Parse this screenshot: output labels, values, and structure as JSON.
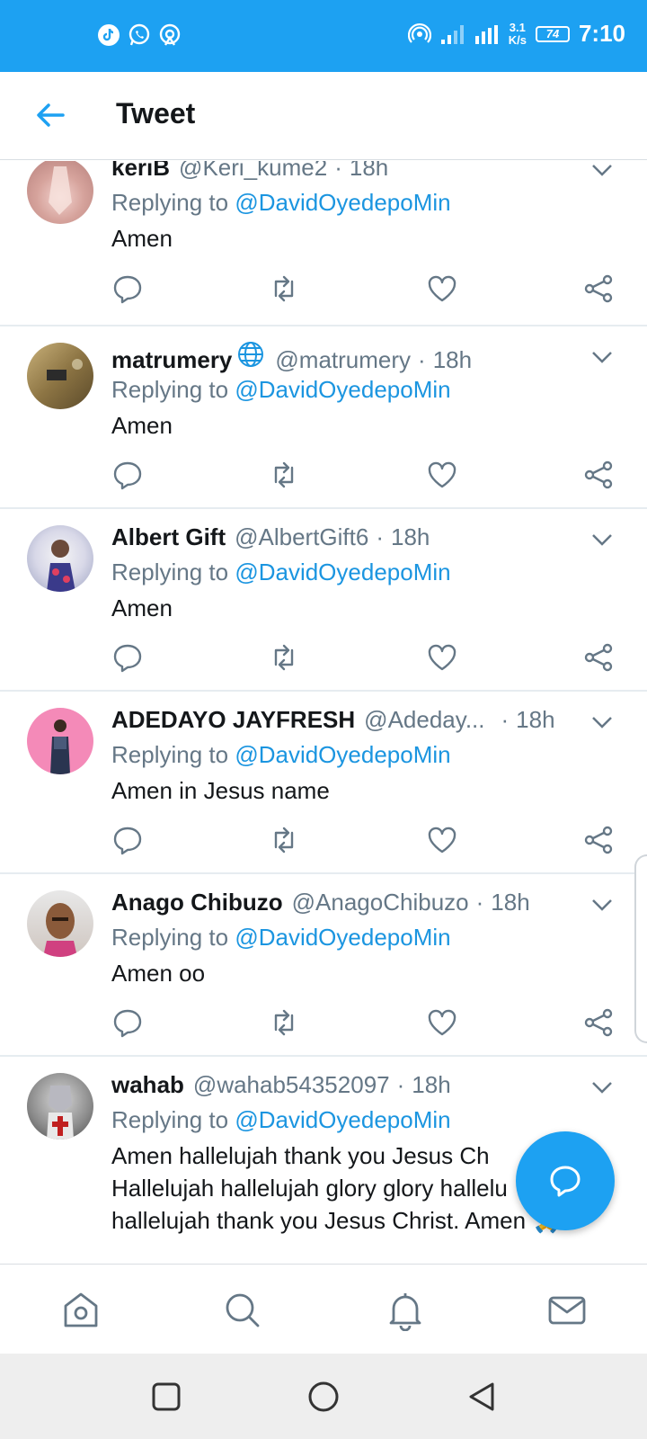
{
  "status_bar": {
    "icons_left": [
      "tiktok-icon",
      "whatsapp-icon",
      "hotspot-icon"
    ],
    "net_speed_value": "3.1",
    "net_speed_unit": "K/s",
    "battery": "74",
    "time": "7:10"
  },
  "header": {
    "back_icon": "arrow-left-icon",
    "title": "Tweet"
  },
  "reply_prefix": "Replying to",
  "reply_mention": "@DavidOyedepoMin",
  "tweets": [
    {
      "name": "keriB",
      "handle": "@Keri_kume2",
      "sep": "·",
      "time": "18h",
      "text": "Amen"
    },
    {
      "name": "matrumery",
      "handle": "@matrumery",
      "sep": "·",
      "time": "18h",
      "text": "Amen"
    },
    {
      "name": "Albert Gift",
      "handle": "@AlbertGift6",
      "sep": "·",
      "time": "18h",
      "text": "Amen"
    },
    {
      "name": "ADEDAYO JAYFRESH",
      "handle": "@Adeday...",
      "sep": "·",
      "time": "18h",
      "text": "Amen in Jesus name"
    },
    {
      "name": "Anago Chibuzo",
      "handle": "@AnagoChibuzo",
      "sep": "·",
      "time": "18h",
      "text": "Amen oo"
    },
    {
      "name": "wahab",
      "handle": "@wahab54352097",
      "sep": "·",
      "time": "18h",
      "text_lines": [
        "Amen hallelujah thank you Jesus Ch",
        "Hallelujah hallelujah glory glory hallelu",
        "hallelujah thank you Jesus Christ. Amen 🙏 !"
      ]
    }
  ],
  "bottom_nav": [
    "home-icon",
    "search-icon",
    "notifications-icon",
    "messages-icon"
  ],
  "system_nav": [
    "recents-icon",
    "home-circle-icon",
    "back-triangle-icon"
  ],
  "colors": {
    "brand": "#1da1f2",
    "mention": "#1b95e0",
    "secondary_text": "#657786"
  }
}
